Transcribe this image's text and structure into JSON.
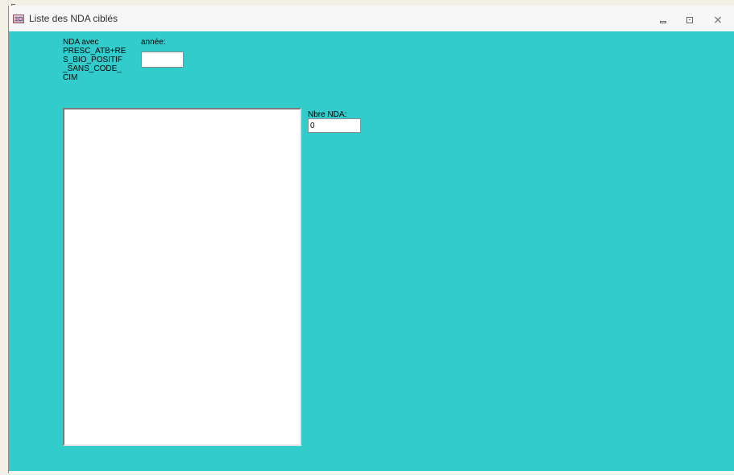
{
  "window": {
    "title": "Liste des NDA ciblés",
    "controls": {
      "minimize_icon": "minimize-icon",
      "restore_icon": "restore-icon",
      "close_icon": "close-icon"
    }
  },
  "form": {
    "background_color": "#33cccc",
    "nda_label": "NDA avec\nPRESC_ATB+RE\nS_BIO_POSITIF\n_SANS_CODE_\nCIM",
    "year_label": "année:",
    "year_value": "",
    "count_label": "Nbre NDA:",
    "count_value": "0",
    "list_items": []
  }
}
